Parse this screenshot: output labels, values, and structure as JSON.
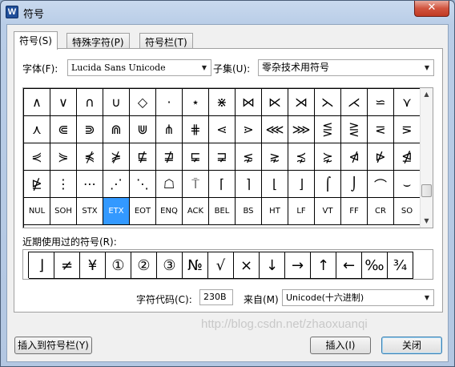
{
  "window": {
    "title": "符号",
    "app_icon": "W",
    "close_glyph": "✕"
  },
  "tabs": [
    {
      "label": "符号(S)",
      "active": true
    },
    {
      "label": "特殊字符(P)",
      "active": false
    },
    {
      "label": "符号栏(T)",
      "active": false
    }
  ],
  "font": {
    "label": "字体(F):",
    "value": "Lucida Sans Unicode"
  },
  "subset": {
    "label": "子集(U):",
    "value": "零杂技术用符号"
  },
  "grid": {
    "selected_index": 63,
    "cells": [
      "∧",
      "∨",
      "∩",
      "∪",
      "◇",
      "·",
      "⋆",
      "⋇",
      "⋈",
      "⋉",
      "⋊",
      "⋋",
      "⋌",
      "⋍",
      "⋎",
      "⋏",
      "⋐",
      "⋑",
      "⋒",
      "⋓",
      "⋔",
      "⋕",
      "⋖",
      "⋗",
      "⋘",
      "⋙",
      "⋚",
      "⋛",
      "⋜",
      "⋝",
      "⋞",
      "⋟",
      "⋠",
      "⋡",
      "⋢",
      "⋣",
      "⋤",
      "⋥",
      "⋦",
      "⋧",
      "⋨",
      "⋩",
      "⋪",
      "⋫",
      "⋬",
      "⋭",
      "⋮",
      "⋯",
      "⋰",
      "⋱",
      "☖",
      "⍑",
      "⌈",
      "⌉",
      "⌊",
      "⌋",
      "⌠",
      "⌡",
      "⌒",
      "⌣",
      "NUL",
      "SOH",
      "STX",
      "ETX",
      "EOT",
      "ENQ",
      "ACK",
      "BEL",
      "BS",
      "HT",
      "LF",
      "VT",
      "FF",
      "CR",
      "SO"
    ]
  },
  "recent": {
    "label": "近期使用过的符号(R):",
    "symbols": [
      "⌋",
      "≠",
      "¥",
      "①",
      "②",
      "③",
      "№",
      "√",
      "×",
      "↓",
      "→",
      "↑",
      "←",
      "‰",
      "¾"
    ]
  },
  "char_code": {
    "label": "字符代码(C):",
    "value": "230B"
  },
  "from": {
    "label": "来自(M)",
    "value": "Unicode(十六进制)"
  },
  "buttons": {
    "insert_to_bar": "插入到符号栏(Y)",
    "insert": "插入(I)",
    "close": "关闭"
  },
  "watermark": "http://blog.csdn.net/zhaoxuanqi"
}
